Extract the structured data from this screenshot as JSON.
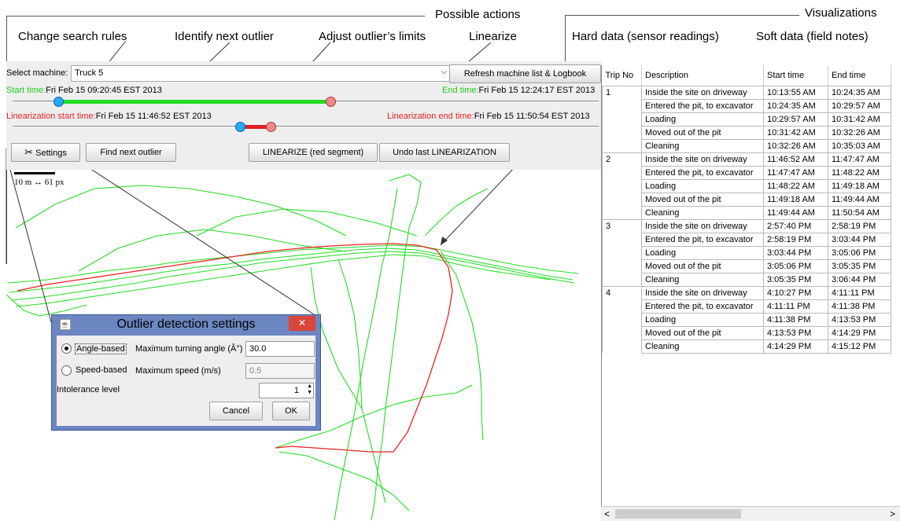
{
  "annotations": {
    "possible_actions": "Possible actions",
    "visualizations": "Visualizations",
    "change_search_rules": "Change search rules",
    "identify_next_outlier": "Identify next outlier",
    "adjust_limits": "Adjust outlier’s limits",
    "linearize": "Linearize",
    "hard_data": "Hard data (sensor readings)",
    "soft_data": "Soft data (field notes)"
  },
  "controls": {
    "select_machine_label": "Select machine:",
    "machine_value": "Truck 5",
    "refresh_button": "Refresh machine list & Logbook",
    "start_time_label": "Start time:",
    "start_time_value": "Fri Feb 15 09:20:45 EST 2013",
    "end_time_label": "End time:",
    "end_time_value": "Fri Feb 15 12:24:17 EST 2013",
    "lin_start_label": "Linearization start time:",
    "lin_start_value": "Fri Feb 15 11:46:52 EST 2013",
    "lin_end_label": "Linearization end time:",
    "lin_end_value": "Fri Feb 15 11:50:54 EST 2013",
    "settings_button": "Settings",
    "find_outlier_button": "Find next outlier",
    "linearize_button": "LINEARIZE (red segment)",
    "undo_button": "Undo last LINEARIZATION",
    "scale_label": "10 m ↔ 61 px"
  },
  "dialog": {
    "title": "Outlier detection settings",
    "angle_label": "Angle-based",
    "angle_field_label": "Maximum turning angle (Â°)",
    "angle_value": "30.0",
    "speed_label": "Speed-based",
    "speed_field_label": "Maximum speed (m/s)",
    "speed_value": "0.5",
    "intolerance_label": "Intolerance level",
    "intolerance_value": "1",
    "cancel": "Cancel",
    "ok": "OK",
    "close": "✕"
  },
  "table": {
    "headers": [
      "Trip No",
      "Description",
      "Start time",
      "End time"
    ],
    "rows": [
      [
        "1",
        "Inside the site on driveway",
        "10:13:55 AM",
        "10:24:35 AM"
      ],
      [
        "",
        "Entered the pit, to excavator",
        "10:24:35 AM",
        "10:29:57 AM"
      ],
      [
        "",
        "Loading",
        "10:29:57 AM",
        "10:31:42 AM"
      ],
      [
        "",
        "Moved out of the pit",
        "10:31:42 AM",
        "10:32:26 AM"
      ],
      [
        "",
        "Cleaning",
        "10:32:26 AM",
        "10:35:03 AM"
      ],
      [
        "2",
        "Inside the site on driveway",
        "11:46:52 AM",
        "11:47:47 AM"
      ],
      [
        "",
        "Entered the pit, to excavator",
        "11:47:47 AM",
        "11:48:22 AM"
      ],
      [
        "",
        "Loading",
        "11:48:22 AM",
        "11:49:18 AM"
      ],
      [
        "",
        "Moved out of the pit",
        "11:49:18 AM",
        "11:49:44 AM"
      ],
      [
        "",
        "Cleaning",
        "11:49:44 AM",
        "11:50:54 AM"
      ],
      [
        "3",
        "Inside the site on driveway",
        "2:57:40 PM",
        "2:58:19 PM"
      ],
      [
        "",
        "Entered the pit, to excavator",
        "2:58:19 PM",
        "3:03:44 PM"
      ],
      [
        "",
        "Loading",
        "3:03:44 PM",
        "3:05:06 PM"
      ],
      [
        "",
        "Moved out of the pit",
        "3:05:06 PM",
        "3:05:35 PM"
      ],
      [
        "",
        "Cleaning",
        "3:05:35 PM",
        "3:06:44 PM"
      ],
      [
        "4",
        "Inside the site on driveway",
        "4:10:27 PM",
        "4:11:11 PM"
      ],
      [
        "",
        "Entered the pit, to excavator",
        "4:11:11 PM",
        "4:11:38 PM"
      ],
      [
        "",
        "Loading",
        "4:11:38 PM",
        "4:13:53 PM"
      ],
      [
        "",
        "Moved out of the pit",
        "4:13:53 PM",
        "4:14:29 PM"
      ],
      [
        "",
        "Cleaning",
        "4:14:29 PM",
        "4:15:12 PM"
      ]
    ],
    "scroll_left": "<",
    "scroll_right": ">"
  },
  "colors": {
    "track_green": "#22dd22",
    "track_red": "#e02020",
    "knob_blue": "#22aaff",
    "knob_red": "#f08888"
  }
}
